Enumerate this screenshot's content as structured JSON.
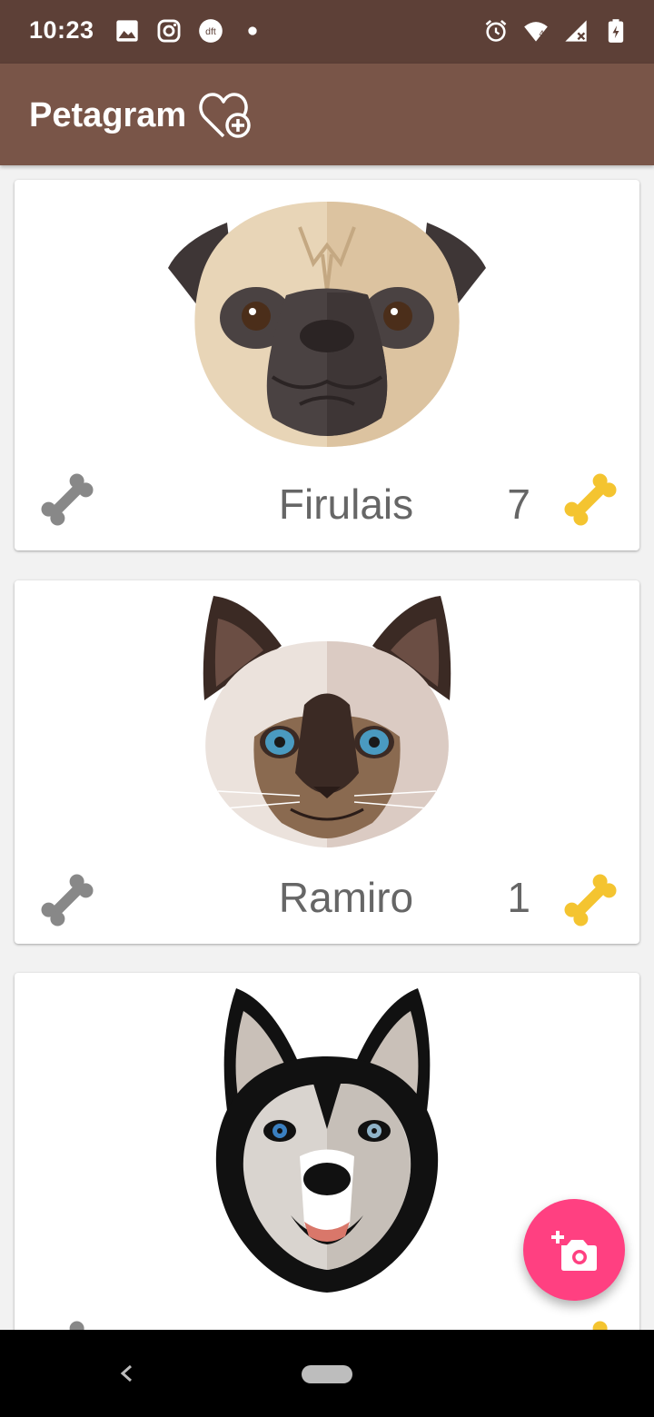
{
  "status_bar": {
    "time": "10:23",
    "left_icons": [
      "image-icon",
      "instagram-icon",
      "dft-icon",
      "dot-icon"
    ],
    "dft_label": "dft",
    "right_icons": [
      "alarm-icon",
      "wifi-icon",
      "signal-icon",
      "battery-icon"
    ],
    "wifi_label": "4"
  },
  "app_bar": {
    "title": "Petagram",
    "action_icon": "heart-plus-icon"
  },
  "pets": [
    {
      "name": "Firulais",
      "likes": "7",
      "image": "pug"
    },
    {
      "name": "Ramiro",
      "likes": "1",
      "image": "siamese-cat"
    },
    {
      "name": "",
      "likes": "",
      "image": "husky"
    }
  ],
  "fab": {
    "icon": "add-photo-icon"
  },
  "nav_bar": {
    "icons": [
      "back-icon",
      "home-pill"
    ]
  },
  "colors": {
    "status_bar": "#5d4037",
    "app_bar": "#795548",
    "fab": "#ff4081",
    "bone_gray": "#888888",
    "bone_gold": "#f4c430",
    "text": "#666666"
  }
}
